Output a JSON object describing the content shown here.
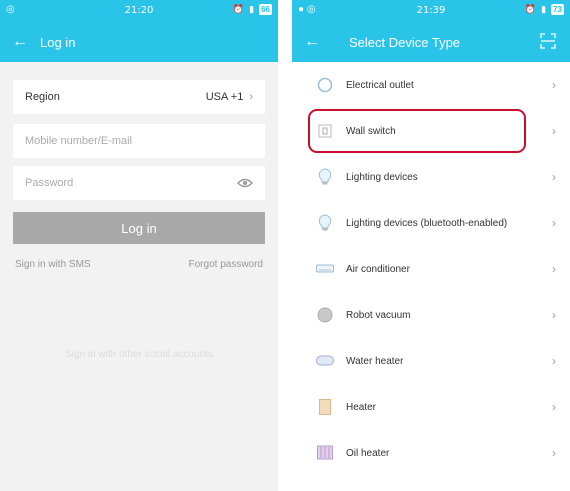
{
  "left": {
    "status": {
      "time": "21:20",
      "battery": "66"
    },
    "header": {
      "title": "Log in"
    },
    "region": {
      "label": "Region",
      "value": "USA +1"
    },
    "mobile": {
      "placeholder": "Mobile number/E-mail"
    },
    "password": {
      "placeholder": "Password"
    },
    "login_button": "Log in",
    "links": {
      "sms": "Sign in with SMS",
      "forgot": "Forgot password"
    },
    "faded_text": "Sign in with other social accounts"
  },
  "right": {
    "status": {
      "time": "21:39",
      "battery": "73"
    },
    "header": {
      "title": "Select Device Type"
    },
    "devices": [
      {
        "label": "Electrical outlet",
        "icon": "outlet-icon"
      },
      {
        "label": "Wall switch",
        "icon": "wall-switch-icon"
      },
      {
        "label": "Lighting devices",
        "icon": "bulb-icon"
      },
      {
        "label": "Lighting devices (bluetooth-enabled)",
        "icon": "bulb-icon"
      },
      {
        "label": "Air conditioner",
        "icon": "air-conditioner-icon"
      },
      {
        "label": "Robot vacuum",
        "icon": "robot-vacuum-icon"
      },
      {
        "label": "Water heater",
        "icon": "water-heater-icon"
      },
      {
        "label": "Heater",
        "icon": "heater-icon"
      },
      {
        "label": "Oil heater",
        "icon": "oil-heater-icon"
      }
    ]
  },
  "colors": {
    "accent": "#29c4e8",
    "highlight": "#c8102e",
    "button_disabled": "#a9a9a9"
  }
}
